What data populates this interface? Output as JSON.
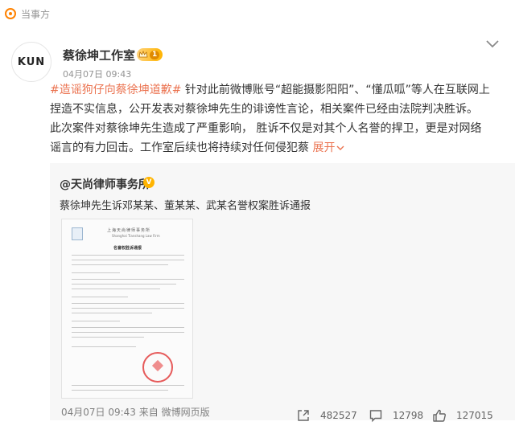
{
  "topbar": {
    "label": "当事方",
    "icon": "circle-dot-icon"
  },
  "post": {
    "author": "蔡徐坤工作室",
    "avatar_text": "KUN",
    "vip_level": "1",
    "time": "04月07日 09:43",
    "hashtag": "#造谣狗仔向蔡徐坤道歉#",
    "lines": [
      " 针对此前微博账号“超能摄影阳阳”、“懂瓜呱”等人在互联网上",
      "捏造不实信息，公开发表对蔡徐坤先生的诽谤性言论，相关案件已经由法院判决胜诉。",
      "此次案件对蔡徐坤先生造成了严重影响， 胜诉不仅是对其个人名誉的捍卫，更是对网络",
      "谣言的有力回击。工作室后续也将持续对任何侵犯蔡 "
    ],
    "expand": "展开"
  },
  "repost": {
    "source": "@天尚律师事务所",
    "verified": "V",
    "text": "蔡徐坤先生诉邓某某、董某某、武某名誉权案胜诉通报",
    "doc": {
      "header": "上海天尚律师事务所",
      "header_en": "Shanghai Tianshang Law Firm",
      "title": "名誉权胜诉通报"
    }
  },
  "footer": {
    "time_source": "04月07日 09:43 来自 微博网页版",
    "reposts": "482527",
    "comments": "12798",
    "likes": "127015"
  },
  "colors": {
    "accent": "#eb7350",
    "orange": "#ff8200",
    "gray_text": "#939393",
    "repost_bg": "#f7f7f7"
  }
}
